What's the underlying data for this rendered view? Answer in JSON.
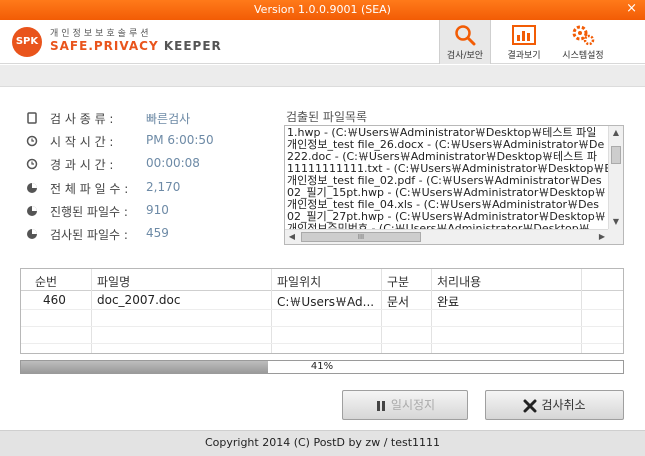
{
  "titlebar": {
    "version": "Version 1.0.0.9001 (SEA)",
    "close": "×"
  },
  "brand": {
    "badge": "SPK",
    "subtitle": "개인정보보호솔루션",
    "name_a": "SAFE.",
    "name_b": "PRIVACY",
    "name_c": " KEEPER"
  },
  "nav": [
    {
      "label": "검사/보안",
      "icon": "magnifier-icon",
      "active": true
    },
    {
      "label": "결과보기",
      "icon": "bar-chart-icon",
      "active": false
    },
    {
      "label": "시스템설정",
      "icon": "gears-icon",
      "active": false
    }
  ],
  "info": {
    "type_label": "검 사 종 류 :",
    "type_value": "빠른검사",
    "start_label": "시 작 시 간 :",
    "start_value": "PM 6:00:50",
    "elapsed_label": "경 과 시 간 :",
    "elapsed_value": "00:00:08",
    "total_label": "전 체 파 일 수 :",
    "total_value": "2,170",
    "progressed_label": "진행된 파일수 :",
    "progressed_value": "910",
    "scanned_label": "검사된 파일수 :",
    "scanned_value": "459"
  },
  "detected": {
    "title": "검출된 파일목록",
    "lines": [
      "1.hwp - (C:￦Users￦Administrator￦Desktop￦테스트 파일",
      "개인정보_test file_26.docx - (C:￦Users￦Administrator￦De",
      "222.doc - (C:￦Users￦Administrator￦Desktop￦테스트 파",
      "11111111111.txt - (C:￦Users￦Administrator￦Desktop￦Bi",
      "개인정보_test file_02.pdf - (C:￦Users￦Administrator￦Des",
      "02_필기_15pt.hwp - (C:￦Users￦Administrator￦Desktop￦",
      "개인정보_test file_04.xls - (C:￦Users￦Administrator￦Des",
      "02_필기_27pt.hwp - (C:￦Users￦Administrator￦Desktop￦",
      "개인정보주민번호 - (C:￦Users￦Administrator￦Desktop￦"
    ],
    "hscroll_thumb": "III"
  },
  "table": {
    "headers": [
      "순번",
      "파일명",
      "파일위치",
      "구분",
      "처리내용"
    ],
    "rows": [
      [
        "460",
        "doc_2007.doc",
        "C:￦Users￦Ad...",
        "문서",
        "완료"
      ]
    ]
  },
  "progress": {
    "fraction": 0.41,
    "text": "41%"
  },
  "buttons": {
    "pause": "일시정지",
    "cancel": "검사취소"
  },
  "footer": {
    "text": "Copyright 2014 (C) PostD by zw / test1111"
  },
  "colors": {
    "accent": "#f25c05",
    "value": "#6d8aa6"
  }
}
